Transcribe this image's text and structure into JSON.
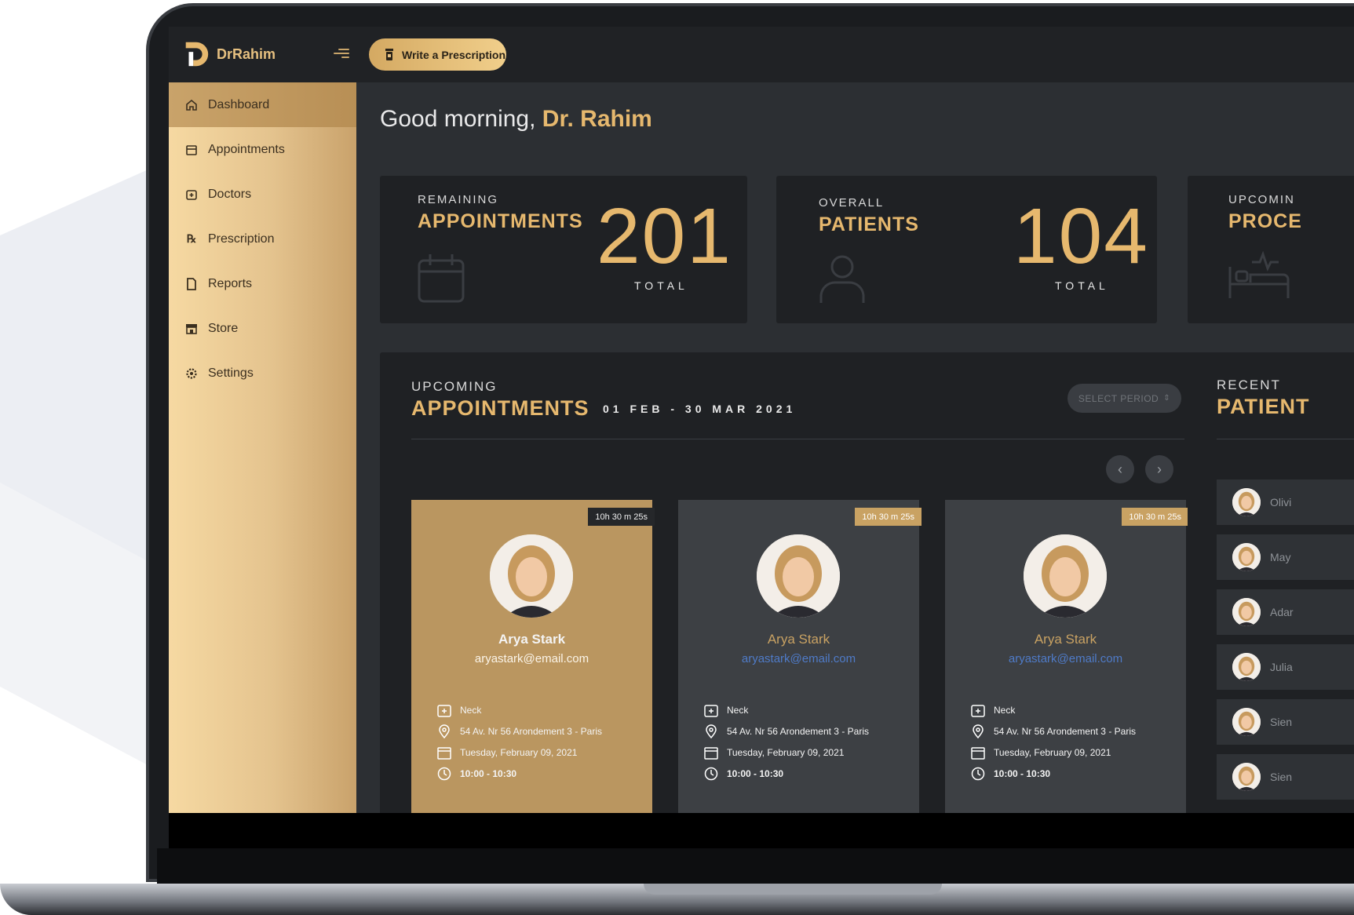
{
  "brand": "DrRahim",
  "topbar": {
    "write_button": "Write a Prescription"
  },
  "sidebar": {
    "items": [
      {
        "label": "Dashboard",
        "icon": "home-icon"
      },
      {
        "label": "Appointments",
        "icon": "calendar-icon"
      },
      {
        "label": "Doctors",
        "icon": "doctor-icon"
      },
      {
        "label": "Prescription",
        "icon": "rx-icon"
      },
      {
        "label": "Reports",
        "icon": "document-icon"
      },
      {
        "label": "Store",
        "icon": "store-icon"
      },
      {
        "label": "Settings",
        "icon": "gear-icon"
      }
    ]
  },
  "greeting": {
    "prefix": "Good morning,",
    "name": "Dr. Rahim"
  },
  "stats": [
    {
      "sub": "REMAINING",
      "title": "APPOINTMENTS",
      "value": "201",
      "total_label": "TOTAL",
      "icon": "calendar-icon"
    },
    {
      "sub": "OVERALL",
      "title": "PATIENTS",
      "value": "104",
      "total_label": "TOTAL",
      "icon": "user-icon"
    },
    {
      "sub": "UPCOMIN",
      "title": "PROCE",
      "icon": "bed-icon"
    }
  ],
  "upcoming": {
    "sub": "UPCOMING",
    "title": "APPOINTMENTS",
    "range": "01 FEB - 30 MAR 2021",
    "period_button": "SELECT PERIOD",
    "cards": [
      {
        "badge": "10h 30 m 25s",
        "name": "Arya Stark",
        "email": "aryastark@email.com",
        "area": "Neck",
        "address": "54 Av. Nr 56 Arondement 3 - Paris",
        "date": "Tuesday, February 09, 2021",
        "time": "10:00 - 10:30"
      },
      {
        "badge": "10h 30 m 25s",
        "name": "Arya Stark",
        "email": "aryastark@email.com",
        "area": "Neck",
        "address": "54 Av. Nr 56 Arondement 3 - Paris",
        "date": "Tuesday, February 09, 2021",
        "time": "10:00 - 10:30"
      },
      {
        "badge": "10h 30 m 25s",
        "name": "Arya Stark",
        "email": "aryastark@email.com",
        "area": "Neck",
        "address": "54 Av. Nr 56 Arondement 3 - Paris",
        "date": "Tuesday, February 09, 2021",
        "time": "10:00 - 10:30"
      }
    ]
  },
  "recent": {
    "sub": "RECENT",
    "title": "PATIENT",
    "patients": [
      "Olivi",
      "May",
      "Adar",
      "Julia",
      "Sien",
      "Sien"
    ]
  },
  "colors": {
    "accent": "#e6b86e",
    "sidebar": "#e4c38e",
    "panel": "#1f2124",
    "email_link": "#4f7bc8"
  }
}
